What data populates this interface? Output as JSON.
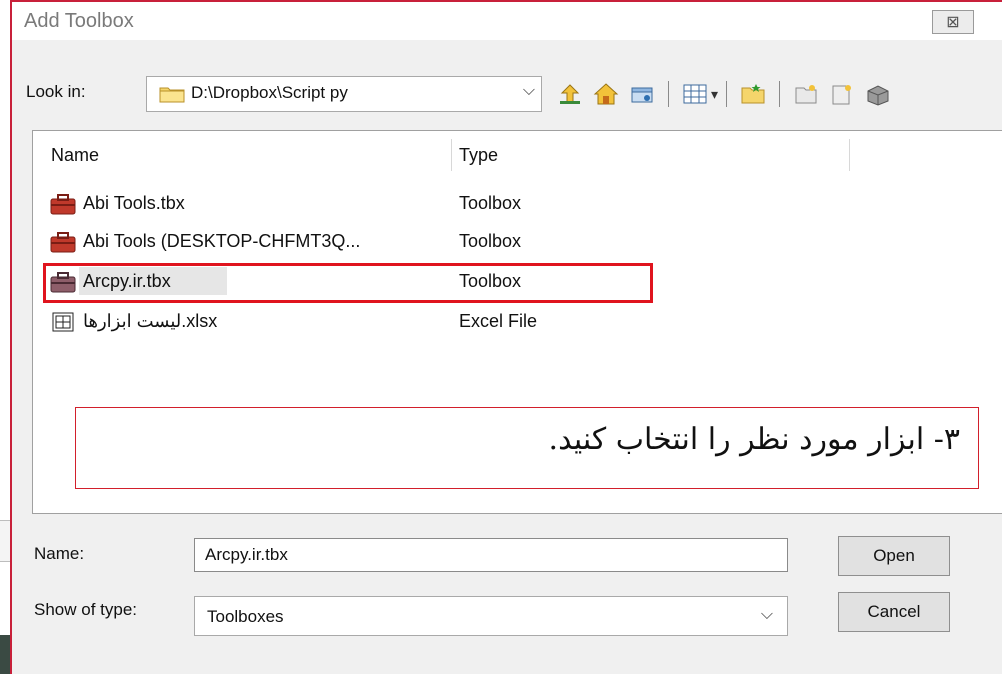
{
  "dialog": {
    "title": "Add Toolbox",
    "close_glyph": "⊠"
  },
  "lookin": {
    "label": "Look in:",
    "path": "D:\\Dropbox\\Script py",
    "chevron": "⌵"
  },
  "toolbar": {
    "icons": [
      "up-one-level-icon",
      "home-icon",
      "connect-folder-icon",
      "view-list-icon",
      "new-folder-icon",
      "new-toolbox-icon",
      "new-file-icon",
      "toolbox-icon"
    ],
    "view_dropdown": "▾"
  },
  "filelist": {
    "columns": {
      "name": "Name",
      "type": "Type"
    },
    "rows": [
      {
        "name": "Abi Tools.tbx",
        "type": "Toolbox"
      },
      {
        "name": "Abi Tools (DESKTOP-CHFMT3Q...",
        "type": "Toolbox"
      },
      {
        "name": "Arcpy.ir.tbx",
        "type": "Toolbox"
      },
      {
        "name": "لیست ابزارها.xlsx",
        "type": "Excel File"
      }
    ],
    "selected_index": 2
  },
  "annotation": {
    "text": "۳- ابزار مورد نظر را انتخاب کنید.",
    "highlight_color": "#e0141e"
  },
  "form": {
    "name_label": "Name:",
    "name_value": "Arcpy.ir.tbx",
    "type_label": "Show of type:",
    "type_value": "Toolboxes",
    "type_chevron": "⌵"
  },
  "buttons": {
    "open": "Open",
    "cancel": "Cancel"
  }
}
